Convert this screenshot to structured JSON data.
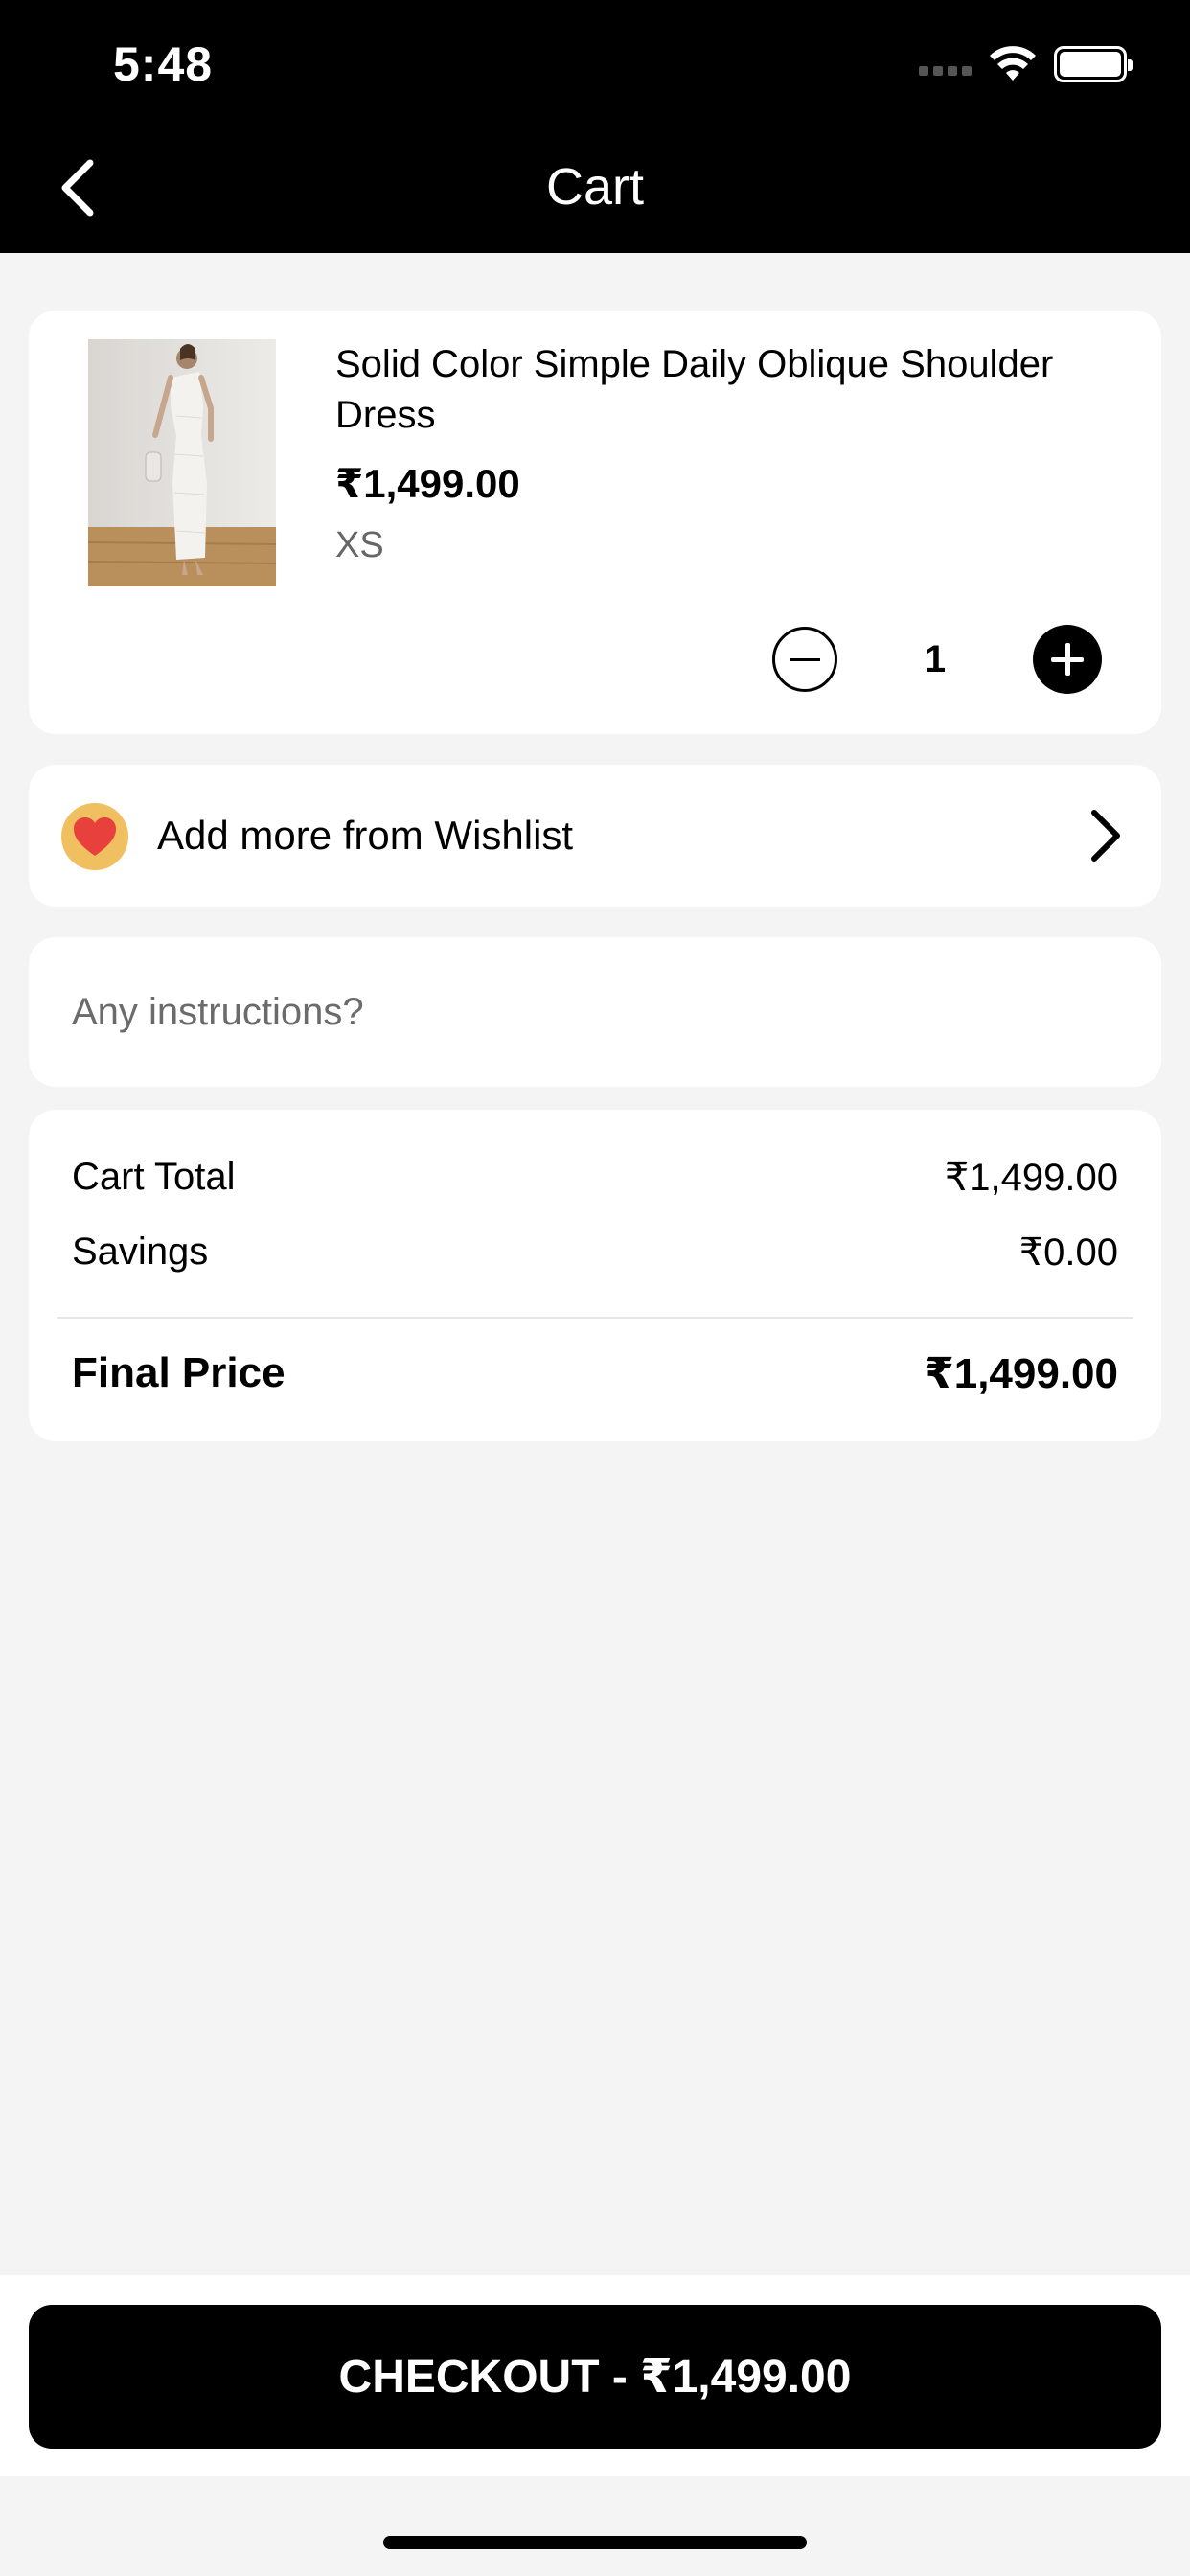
{
  "status_bar": {
    "time": "5:48"
  },
  "header": {
    "title": "Cart"
  },
  "cart_item": {
    "name": "Solid Color Simple Daily Oblique Shoulder Dress",
    "price": "₹1,499.00",
    "size": "XS",
    "quantity": "1"
  },
  "wishlist": {
    "label": "Add more from Wishlist"
  },
  "instructions": {
    "placeholder": "Any instructions?"
  },
  "summary": {
    "cart_total_label": "Cart Total",
    "cart_total_value": "₹1,499.00",
    "savings_label": "Savings",
    "savings_value": "₹0.00",
    "final_label": "Final Price",
    "final_value": "₹1,499.00"
  },
  "checkout": {
    "label": "CHECKOUT - ₹1,499.00"
  },
  "colors": {
    "header_bg": "#000000",
    "page_bg": "#f4f4f4",
    "card_bg": "#ffffff",
    "heart_badge": "#f0c060",
    "heart": "#e8403c"
  },
  "icons": [
    "back-arrow-icon",
    "wifi-icon",
    "battery-icon",
    "minus-icon",
    "plus-icon",
    "heart-icon",
    "chevron-right-icon"
  ]
}
